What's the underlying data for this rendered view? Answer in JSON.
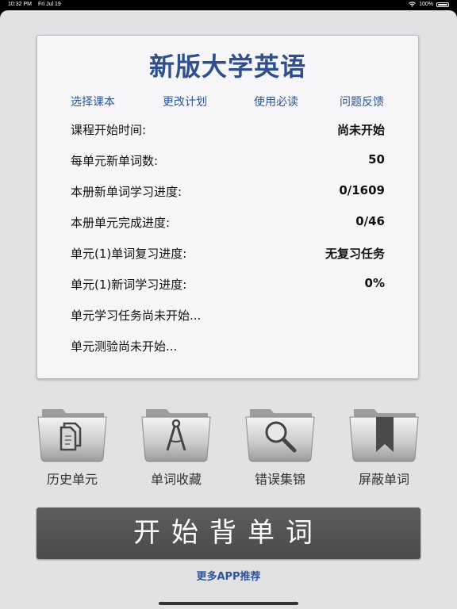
{
  "status": {
    "time": "10:32 PM",
    "date": "Fri Jul 19",
    "battery": "100%"
  },
  "card": {
    "title": "新版大学英语",
    "links": [
      "选择课本",
      "更改计划",
      "使用必读",
      "问题反馈"
    ],
    "rows": [
      {
        "label": "课程开始时间:",
        "value": "尚未开始"
      },
      {
        "label": "每单元新单词数:",
        "value": "50"
      },
      {
        "label": "本册新单词学习进度:",
        "value": "0/1609"
      },
      {
        "label": "本册单元完成进度:",
        "value": "0/46"
      },
      {
        "label": "单元(1)单词复习进度:",
        "value": "无复习任务"
      },
      {
        "label": "单元(1)新词学习进度:",
        "value": "0%"
      },
      {
        "label": "单元学习任务尚未开始...",
        "value": ""
      },
      {
        "label": "单元测验尚未开始...",
        "value": ""
      }
    ]
  },
  "folders": [
    {
      "label": "历史单元",
      "icon": "documents-icon"
    },
    {
      "label": "单词收藏",
      "icon": "compass-icon"
    },
    {
      "label": "错误集锦",
      "icon": "magnifier-icon"
    },
    {
      "label": "屏蔽单词",
      "icon": "bookmark-icon"
    }
  ],
  "start_button": "开始背单词",
  "more_apps": "更多APP推荐",
  "colors": {
    "accent": "#2f5596",
    "title": "#2f4f8f",
    "button": "#555555"
  }
}
